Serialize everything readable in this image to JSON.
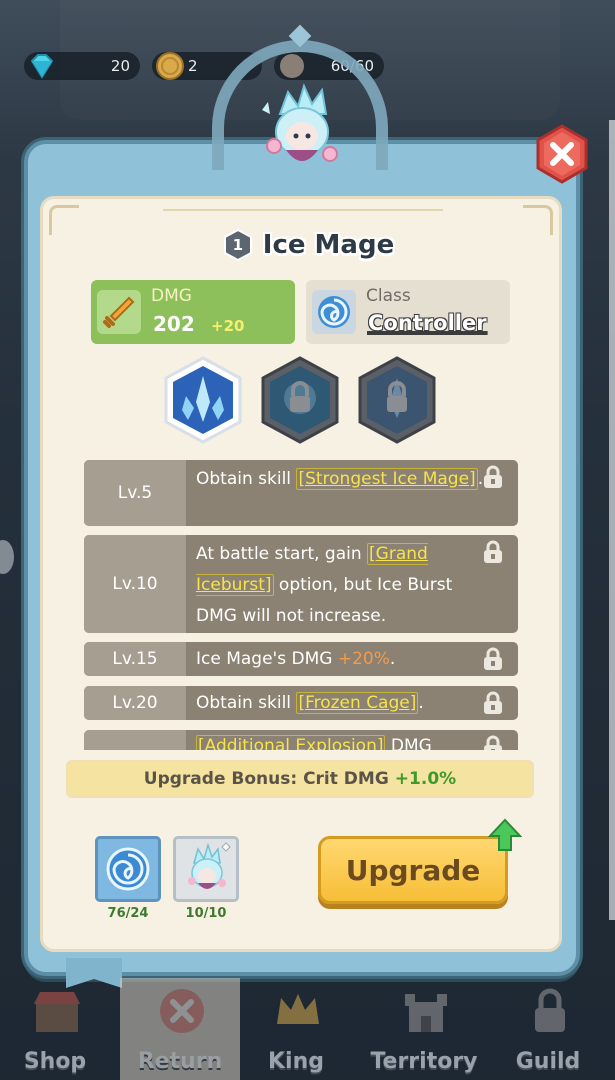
{
  "currencies": {
    "gems": "20",
    "gold": "2",
    "stamina": "60/60"
  },
  "hero": {
    "rank": "1",
    "name": "Ice Mage"
  },
  "stats": {
    "dmg_label": "DMG",
    "dmg_value": "202",
    "dmg_bonus": "+20",
    "class_label": "Class",
    "class_value": "Controller"
  },
  "skills": [
    {
      "level": "Lv.5",
      "parts": [
        "Obtain skill ",
        "[Strongest Ice Mage]",
        "."
      ]
    },
    {
      "level": "Lv.10",
      "parts": [
        "At battle start, gain ",
        "[Grand Iceburst]",
        " option, but Ice Burst DMG will not increase."
      ]
    },
    {
      "level": "Lv.15",
      "parts": [
        "Ice Mage's DMG ",
        "+20%",
        "."
      ]
    },
    {
      "level": "Lv.20",
      "parts": [
        "Obtain skill ",
        "[Frozen Cage]",
        "."
      ]
    },
    {
      "level": "",
      "parts": [
        "[Additional Explosion]",
        " DMG"
      ]
    }
  ],
  "upgrade_bonus": {
    "label": "Upgrade Bonus: Crit DMG",
    "value": "+1.0%"
  },
  "materials": [
    {
      "icon": "swirl-icon",
      "count": "76/24"
    },
    {
      "icon": "ice-mage-shard-icon",
      "count": "10/10"
    }
  ],
  "upgrade_button": "Upgrade",
  "nav": [
    "Shop",
    "Return",
    "King",
    "Territory",
    "Guild"
  ],
  "colors": {
    "upgrade": "#f7be37",
    "dmg_card": "#8dc05a",
    "highlight": "#f7e34a",
    "close": "#e0524a"
  }
}
